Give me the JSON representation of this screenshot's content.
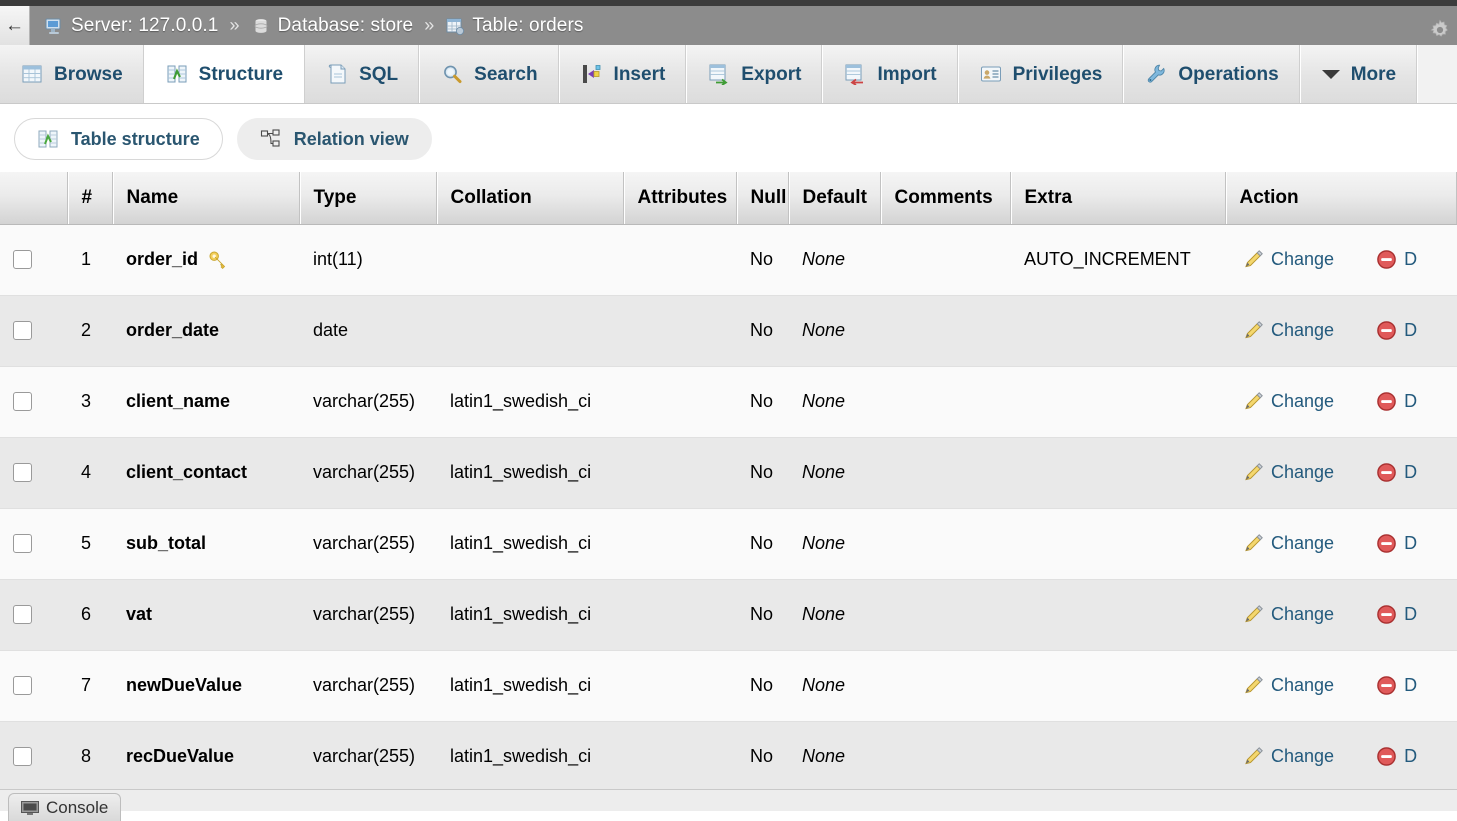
{
  "breadcrumb": {
    "back_label": "←",
    "server": {
      "label": "Server: 127.0.0.1",
      "icon": "server-icon"
    },
    "database": {
      "label": "Database: store",
      "icon": "database-icon"
    },
    "table": {
      "label": "Table: orders",
      "icon": "table-icon"
    },
    "separator": "»",
    "settings_icon": "gear-icon"
  },
  "main_tabs": [
    {
      "label": "Browse",
      "icon": "browse-icon",
      "active": false
    },
    {
      "label": "Structure",
      "icon": "structure-icon",
      "active": true
    },
    {
      "label": "SQL",
      "icon": "sql-icon",
      "active": false
    },
    {
      "label": "Search",
      "icon": "search-icon",
      "active": false
    },
    {
      "label": "Insert",
      "icon": "insert-icon",
      "active": false
    },
    {
      "label": "Export",
      "icon": "export-icon",
      "active": false
    },
    {
      "label": "Import",
      "icon": "import-icon",
      "active": false
    },
    {
      "label": "Privileges",
      "icon": "privileges-icon",
      "active": false
    },
    {
      "label": "Operations",
      "icon": "operations-icon",
      "active": false
    },
    {
      "label": "More",
      "icon": "chevron-down-icon",
      "active": false
    }
  ],
  "sub_tabs": [
    {
      "label": "Table structure",
      "icon": "structure-icon",
      "active": true
    },
    {
      "label": "Relation view",
      "icon": "relation-icon",
      "active": false
    }
  ],
  "table": {
    "headers": [
      "",
      "#",
      "Name",
      "Type",
      "Collation",
      "Attributes",
      "Null",
      "Default",
      "Comments",
      "Extra",
      "Action"
    ],
    "rows": [
      {
        "num": "1",
        "name": "order_id",
        "primary_key": true,
        "type": "int(11)",
        "collation": "",
        "attributes": "",
        "null": "No",
        "default": "None",
        "comments": "",
        "extra": "AUTO_INCREMENT",
        "change": "Change",
        "drop": "D"
      },
      {
        "num": "2",
        "name": "order_date",
        "primary_key": false,
        "type": "date",
        "collation": "",
        "attributes": "",
        "null": "No",
        "default": "None",
        "comments": "",
        "extra": "",
        "change": "Change",
        "drop": "D"
      },
      {
        "num": "3",
        "name": "client_name",
        "primary_key": false,
        "type": "varchar(255)",
        "collation": "latin1_swedish_ci",
        "attributes": "",
        "null": "No",
        "default": "None",
        "comments": "",
        "extra": "",
        "change": "Change",
        "drop": "D"
      },
      {
        "num": "4",
        "name": "client_contact",
        "primary_key": false,
        "type": "varchar(255)",
        "collation": "latin1_swedish_ci",
        "attributes": "",
        "null": "No",
        "default": "None",
        "comments": "",
        "extra": "",
        "change": "Change",
        "drop": "D"
      },
      {
        "num": "5",
        "name": "sub_total",
        "primary_key": false,
        "type": "varchar(255)",
        "collation": "latin1_swedish_ci",
        "attributes": "",
        "null": "No",
        "default": "None",
        "comments": "",
        "extra": "",
        "change": "Change",
        "drop": "D"
      },
      {
        "num": "6",
        "name": "vat",
        "primary_key": false,
        "type": "varchar(255)",
        "collation": "latin1_swedish_ci",
        "attributes": "",
        "null": "No",
        "default": "None",
        "comments": "",
        "extra": "",
        "change": "Change",
        "drop": "D"
      },
      {
        "num": "7",
        "name": "newDueValue",
        "primary_key": false,
        "type": "varchar(255)",
        "collation": "latin1_swedish_ci",
        "attributes": "",
        "null": "No",
        "default": "None",
        "comments": "",
        "extra": "",
        "change": "Change",
        "drop": "D"
      },
      {
        "num": "8",
        "name": "recDueValue",
        "primary_key": false,
        "type": "varchar(255)",
        "collation": "latin1_swedish_ci",
        "attributes": "",
        "null": "No",
        "default": "None",
        "comments": "",
        "extra": "",
        "change": "Change",
        "drop": "D"
      }
    ]
  },
  "console": {
    "label": "Console",
    "icon": "monitor-icon"
  },
  "colors": {
    "breadcrumb_bg": "#8c8c8c",
    "topstrip_bg": "#3c3c3c",
    "tab_text": "#1f4e6e",
    "link": "#235a7d",
    "row_odd": "#fafafa",
    "row_even": "#e9e9e9",
    "key_gold": "#f0c244",
    "drop_red": "#d94141"
  }
}
